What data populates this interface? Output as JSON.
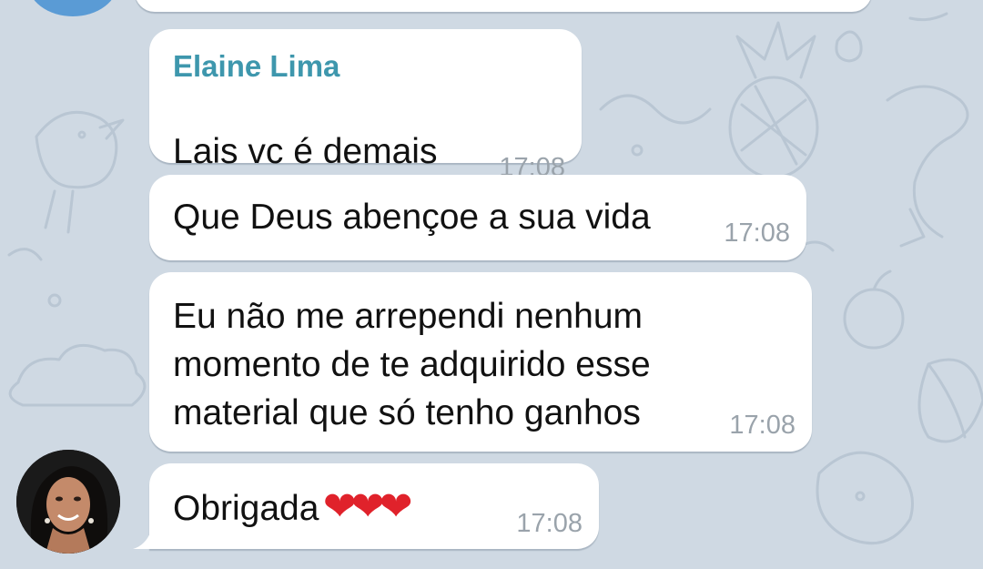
{
  "chat": {
    "messages": [
      {
        "sender": "Elaine Lima",
        "text": "Lais vc é demais",
        "time": "17:08"
      },
      {
        "text": "Que Deus abençoe a sua vida",
        "time": "17:08"
      },
      {
        "lines": [
          "Eu não me arrependi nenhum",
          "momento de te adquirido esse",
          "material que só tenho ganhos"
        ],
        "time": "17:08"
      },
      {
        "text": "Obrigada",
        "emoji": "❤❤❤",
        "time": "17:08"
      }
    ]
  },
  "colors": {
    "background": "#cfd9e3",
    "bubble": "#ffffff",
    "sender_name": "#3e97ad",
    "timestamp": "#9aa3ab",
    "heart": "#e0222b",
    "top_avatar": "#5a9bd5"
  },
  "icons": {
    "sender_avatar": "user-avatar-photo",
    "hearts": "red-heart-emoji"
  }
}
